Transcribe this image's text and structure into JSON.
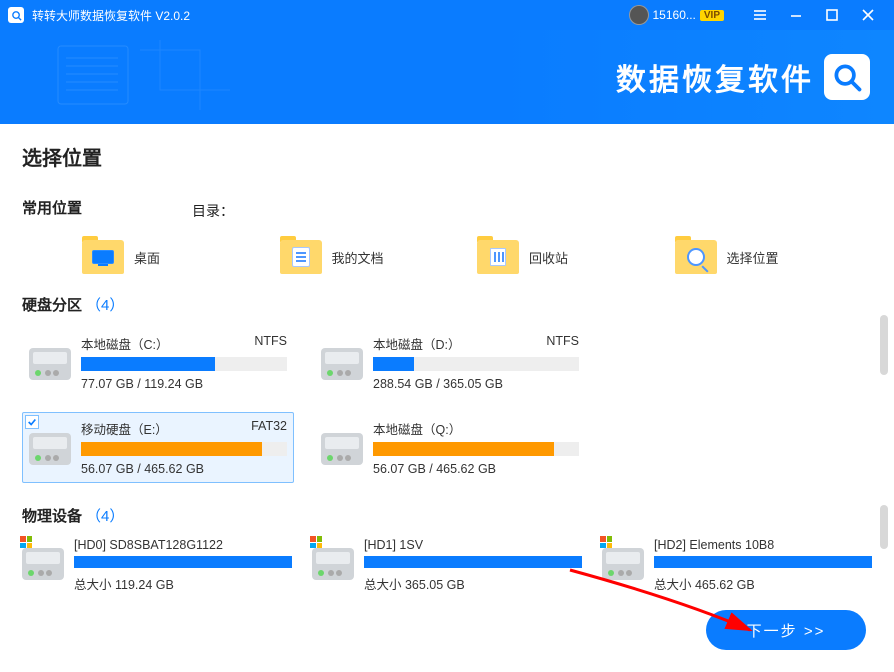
{
  "titlebar": {
    "app_title": "转转大师数据恢复软件 V2.0.2",
    "user_name": "15160...",
    "vip_label": "VIP"
  },
  "banner": {
    "brand_text": "数据恢复软件"
  },
  "content": {
    "page_title": "选择位置",
    "common_label": "常用位置",
    "dir_label": "目录：",
    "common_items": [
      {
        "label": "桌面"
      },
      {
        "label": "我的文档"
      },
      {
        "label": "回收站"
      },
      {
        "label": "选择位置"
      }
    ],
    "partitions_label": "硬盘分区",
    "partitions_count": "（4）",
    "partitions": [
      {
        "name": "本地磁盘（C:）",
        "fs": "NTFS",
        "size": "77.07 GB / 119.24 GB",
        "pct": 65,
        "color": "blue",
        "selected": false
      },
      {
        "name": "本地磁盘（D:）",
        "fs": "NTFS",
        "size": "288.54 GB / 365.05 GB",
        "pct": 20,
        "color": "blue",
        "selected": false
      },
      {
        "name": "移动硬盘（E:）",
        "fs": "FAT32",
        "size": "56.07 GB / 465.62 GB",
        "pct": 88,
        "color": "orange",
        "selected": true
      },
      {
        "name": "本地磁盘（Q:）",
        "fs": "",
        "size": "56.07 GB / 465.62 GB",
        "pct": 88,
        "color": "orange",
        "selected": false
      }
    ],
    "physical_label": "物理设备",
    "physical_count": "（4）",
    "physical": [
      {
        "name": "[HD0] SD8SBAT128G1122",
        "total_label": "总大小 119.24 GB",
        "pct": 100
      },
      {
        "name": "[HD1] 1SV",
        "total_label": "总大小 365.05 GB",
        "pct": 100
      },
      {
        "name": "[HD2] Elements 10B8",
        "total_label": "总大小 465.62 GB",
        "pct": 100
      }
    ],
    "next_label": "下一步 >>"
  }
}
